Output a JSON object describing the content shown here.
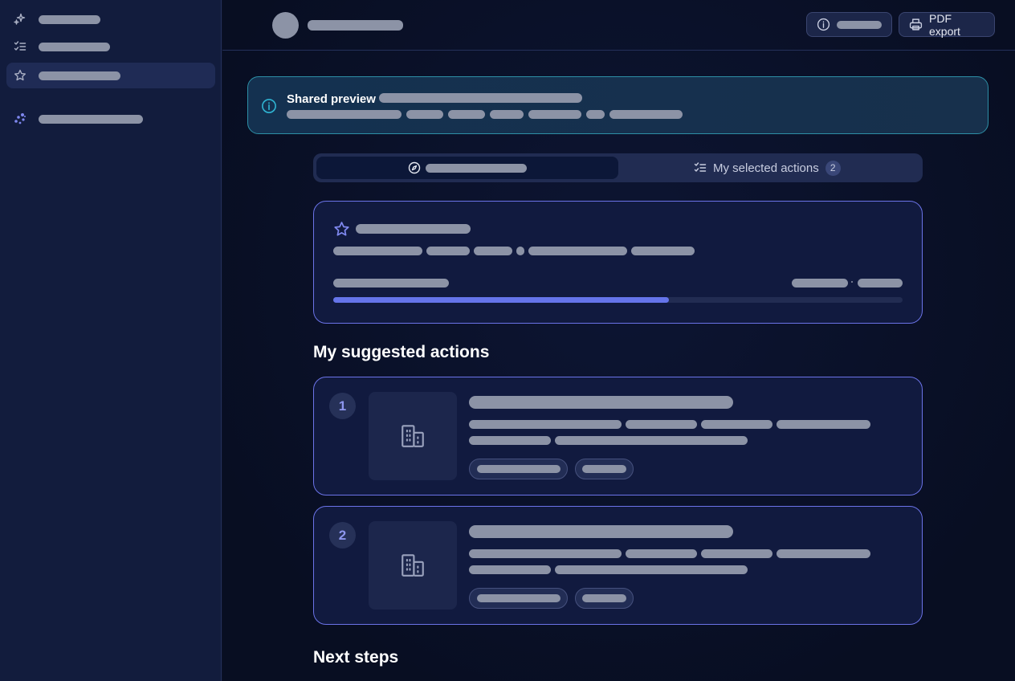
{
  "banner": {
    "title": "Shared preview"
  },
  "header": {
    "export_label": "PDF export"
  },
  "tabs": {
    "selected_label": "My selected actions",
    "selected_count": "2"
  },
  "sections": {
    "suggested": "My suggested actions",
    "next_steps": "Next steps"
  },
  "actions": [
    {
      "number": "1"
    },
    {
      "number": "2"
    }
  ],
  "summary_card": {
    "progress_fraction": 0.59
  },
  "colors": {
    "accent": "#6574ea",
    "info": "#2fb3d1",
    "card_border": "#6b73e8"
  },
  "icons": {
    "sidebar": [
      "sparkles-icon",
      "checklist-icon",
      "star-icon",
      "sparkles-icon"
    ],
    "header": [
      "info-icon",
      "printer-icon"
    ],
    "banner": "info-icon",
    "tabs": [
      "compass-icon",
      "checklist-icon"
    ],
    "action_thumb": "building-icon"
  }
}
